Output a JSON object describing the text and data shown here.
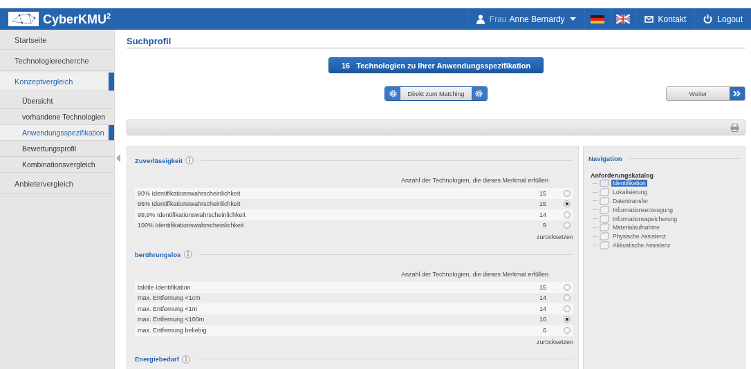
{
  "header": {
    "brand": "CyberKMU",
    "brand_sup": "2",
    "salutation": "Frau",
    "user": "Anne Bernardy",
    "contact": "Kontakt",
    "logout": "Logout"
  },
  "sidebar": {
    "items": [
      {
        "label": "Startseite",
        "selected": false
      },
      {
        "label": "Technologierecherche",
        "selected": false
      },
      {
        "label": "Konzeptvergleich",
        "selected": true,
        "children": [
          {
            "label": "Übersicht",
            "selected": false
          },
          {
            "label": "vorhandene Technologien",
            "selected": false
          },
          {
            "label": "Anwendungsspezifikation",
            "selected": true
          },
          {
            "label": "Bewertungsprofil",
            "selected": false
          },
          {
            "label": "Kombinationsvergleich",
            "selected": false
          }
        ]
      },
      {
        "label": "Anbietervergleich",
        "selected": false
      }
    ]
  },
  "page_title": "Suchprofil",
  "result_button": {
    "count": "16",
    "label": "Technologien zu Ihrer Anwendungsspezifikation"
  },
  "matching_button": "Direkt zum Matching",
  "next_button": "Weiter",
  "sections": [
    {
      "title": "Zuverlässigkeit",
      "column_header": "Anzahl der Technologien, die dieses Merkmal erfüllen",
      "reset": "zurücksetzen",
      "rows": [
        {
          "label": "90% Identifikationswahrscheinlichkeit",
          "count": "15",
          "selected": false
        },
        {
          "label": "95% Identifikationswahrscheinlichkeit",
          "count": "15",
          "selected": true
        },
        {
          "label": "99,9% Identifikationswahrscheinlichkeit",
          "count": "14",
          "selected": false
        },
        {
          "label": "100% Identifikationswahrscheinlichkeit",
          "count": "9",
          "selected": false
        }
      ]
    },
    {
      "title": "berührungslos",
      "column_header": "Anzahl der Technologien, die dieses Merkmal erfüllen",
      "reset": "zurücksetzen",
      "rows": [
        {
          "label": "taktile Identifikation",
          "count": "15",
          "selected": false
        },
        {
          "label": "max. Entfernung <1cm",
          "count": "14",
          "selected": false
        },
        {
          "label": "max. Entfernung <1m",
          "count": "14",
          "selected": false
        },
        {
          "label": "max. Entfernung <100m",
          "count": "10",
          "selected": true
        },
        {
          "label": "max. Entfernung beliebig",
          "count": "6",
          "selected": false
        }
      ]
    },
    {
      "title": "Energiebedarf"
    }
  ],
  "navigation": {
    "title": "Navigation",
    "tree_root": "Anforderungskatalog",
    "items": [
      {
        "label": "Identifikation",
        "selected": true
      },
      {
        "label": "Lokalisierung",
        "selected": false
      },
      {
        "label": "Datentransfer",
        "selected": false
      },
      {
        "label": "Informationserzeugung",
        "selected": false
      },
      {
        "label": "Informationsspeicherung",
        "selected": false
      },
      {
        "label": "Materialaufnahme",
        "selected": false
      },
      {
        "label": "Physische Assistenz",
        "selected": false
      },
      {
        "label": "Akkustische Assistenz",
        "selected": false
      }
    ]
  }
}
